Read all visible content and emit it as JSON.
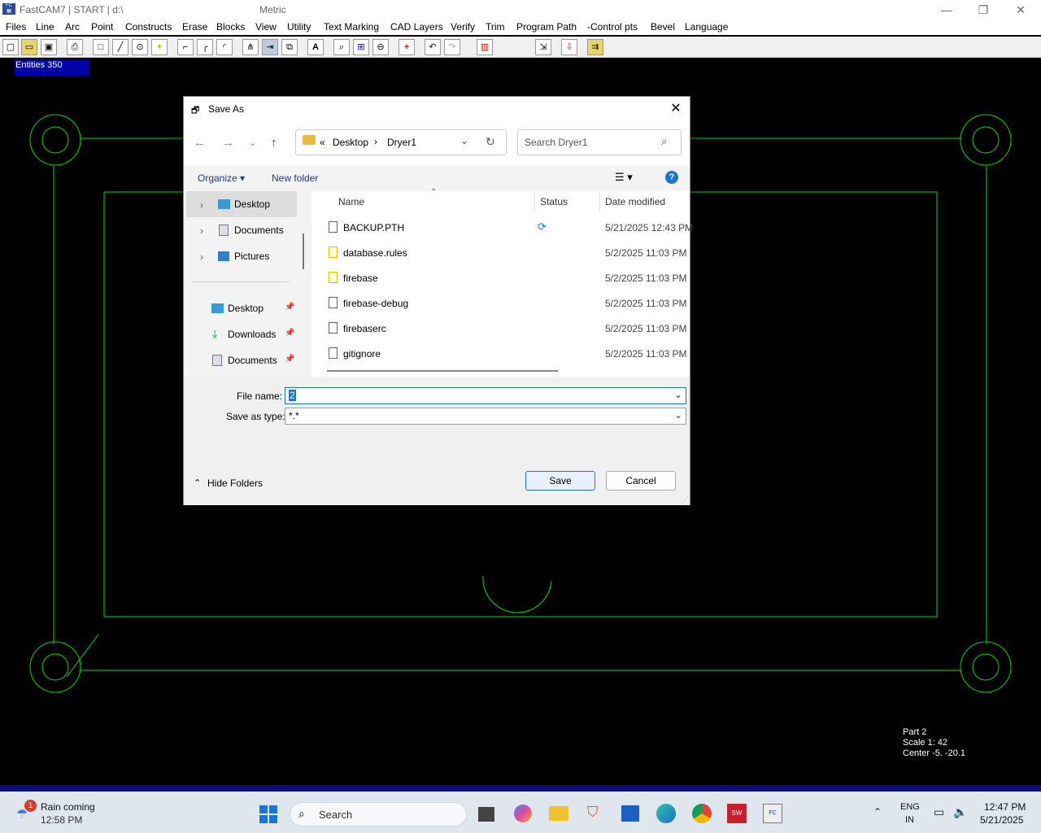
{
  "app": {
    "title": "FastCAM7  |  START  |  d:\\",
    "units": "Metric"
  },
  "window_controls": {
    "minimize": "—",
    "maximize": "❐",
    "close": "✕"
  },
  "menu": [
    "Files",
    "Line",
    "Arc",
    "Point",
    "Constructs",
    "Erase",
    "Blocks",
    "View",
    "Utility",
    "Text Marking",
    "CAD Layers",
    "Verify",
    "Trim",
    "Program Path",
    "-Control pts",
    "Bevel",
    "Language"
  ],
  "canvas": {
    "entities_label": "Entities  350",
    "part": "Part     2",
    "scale": "Scale    1: 42",
    "center": "Center   -5. -20.1",
    "line_color": "#00e000"
  },
  "dialog": {
    "title": "Save As",
    "breadcrumb": {
      "root": "«",
      "folder1": "Desktop",
      "sep": "›",
      "folder2": "Dryer1"
    },
    "search_placeholder": "Search Dryer1",
    "organize": "Organize ▾",
    "new_folder": "New folder",
    "nav_tree": [
      {
        "label": "Desktop"
      },
      {
        "label": "Documents"
      },
      {
        "label": "Pictures"
      }
    ],
    "quick_access": [
      {
        "label": "Desktop"
      },
      {
        "label": "Downloads"
      },
      {
        "label": "Documents"
      }
    ],
    "columns": {
      "name": "Name",
      "status": "Status",
      "date": "Date modified"
    },
    "files": [
      {
        "name": "BACKUP.PTH",
        "date": "5/21/2025 12:43 PM"
      },
      {
        "name": "database.rules",
        "date": "5/2/2025 11:03 PM"
      },
      {
        "name": "firebase",
        "date": "5/2/2025 11:03 PM"
      },
      {
        "name": "firebase-debug",
        "date": "5/2/2025 11:03 PM"
      },
      {
        "name": "firebaserc",
        "date": "5/2/2025 11:03 PM"
      },
      {
        "name": "gitignore",
        "date": "5/2/2025 11:03 PM"
      }
    ],
    "filename_label": "File name:",
    "filename_value": "2",
    "savetype_label": "Save as type:",
    "savetype_value": "*.*",
    "hide_folders": "Hide Folders",
    "save": "Save",
    "cancel": "Cancel"
  },
  "taskbar": {
    "weather_title": "Rain coming",
    "weather_time": "12:58 PM",
    "weather_badge": "1",
    "search": "Search",
    "lang1": "ENG",
    "lang2": "IN",
    "time": "12:47 PM",
    "date": "5/21/2025"
  }
}
